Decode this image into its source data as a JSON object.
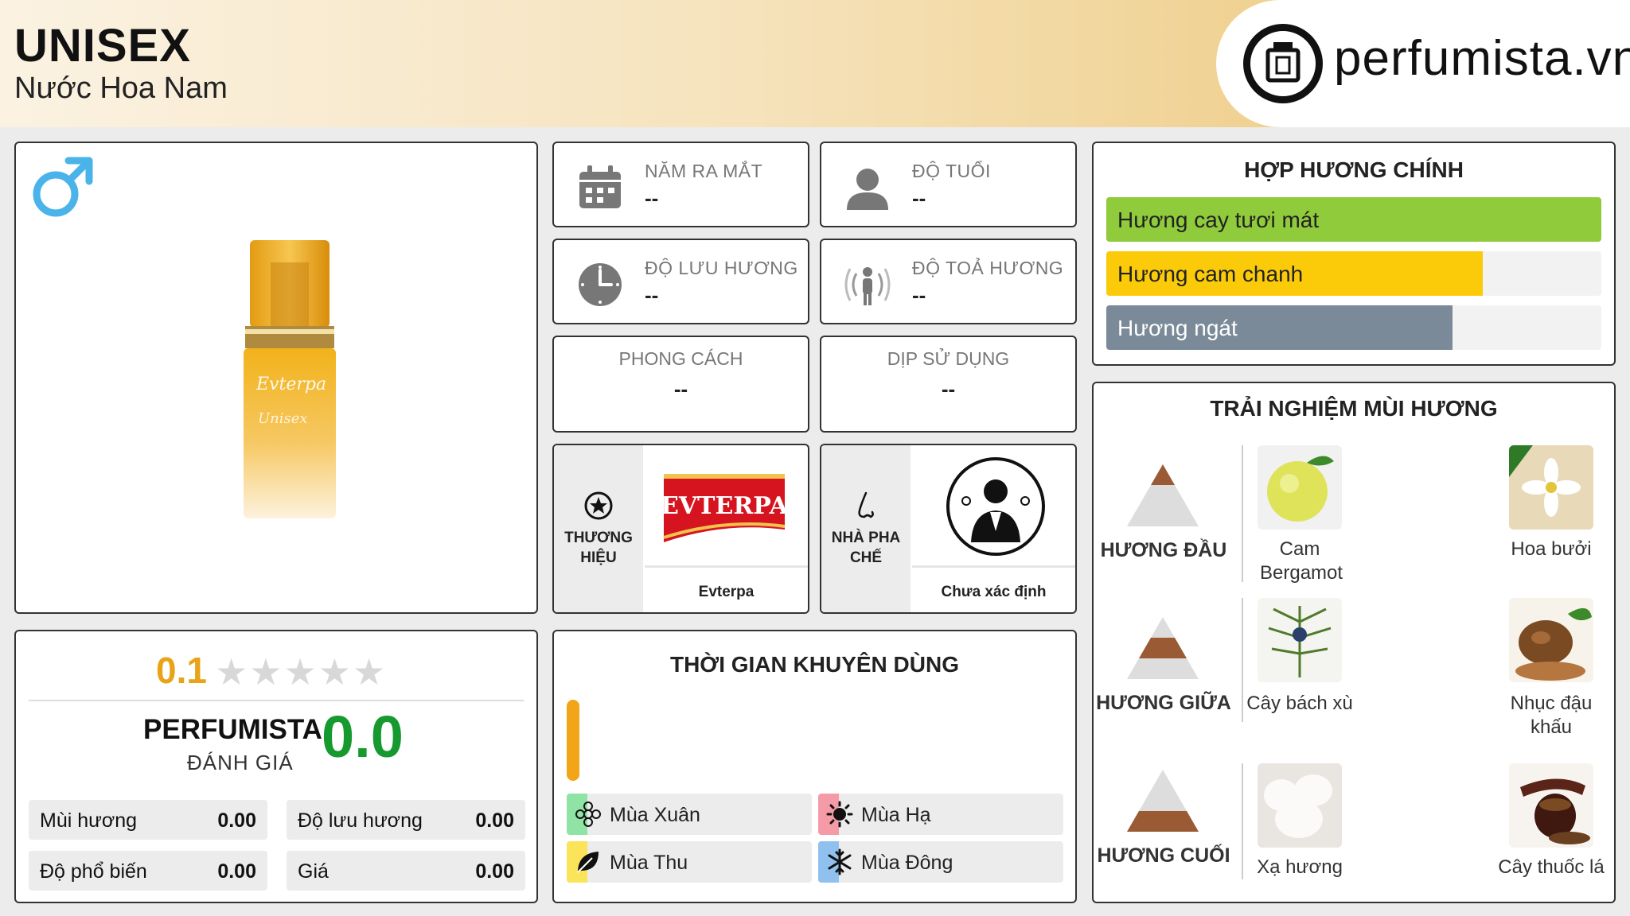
{
  "header": {
    "title": "UNISEX",
    "subtitle": "Nước Hoa Nam",
    "logo_text": "perfumista.vn"
  },
  "product": {
    "gender_icon": "male-icon",
    "gender_color": "#4ab3ea"
  },
  "info": {
    "release_year": {
      "label": "NĂM RA MẮT",
      "value": "--",
      "icon": "calendar-icon"
    },
    "age": {
      "label": "ĐỘ TUỔI",
      "value": "--",
      "icon": "user-icon"
    },
    "longevity": {
      "label": "ĐỘ LƯU HƯƠNG",
      "value": "--",
      "icon": "clock-icon"
    },
    "sillage": {
      "label": "ĐỘ TOẢ HƯƠNG",
      "value": "--",
      "icon": "radiate-icon"
    },
    "style": {
      "label": "PHONG CÁCH",
      "value": "--"
    },
    "occasion": {
      "label": "DỊP SỬ DỤNG",
      "value": "--"
    },
    "brand": {
      "label_line1": "THƯƠNG",
      "label_line2": "HIỆU",
      "logo_text": "EVTERPA",
      "name": "Evterpa",
      "icon": "star-icon"
    },
    "perfumer": {
      "label_line1": "NHÀ PHA",
      "label_line2": "CHẾ",
      "name": "Chưa xác định",
      "icon": "nose-icon"
    }
  },
  "accords": {
    "title": "HỢP HƯƠNG CHÍNH",
    "items": [
      {
        "label": "Hương cay tươi mát",
        "percent": 100,
        "color": "#8fcb3a",
        "text_color": "#222"
      },
      {
        "label": "Hương cam chanh",
        "percent": 76,
        "color": "#fbcb0a",
        "text_color": "#222"
      },
      {
        "label": "Hương ngát",
        "percent": 70,
        "color": "#7a8a99",
        "text_color": "#fff"
      }
    ]
  },
  "rating": {
    "user_score": "0.1",
    "stars_filled": 0,
    "stars_total": 5,
    "perfumista_title": "PERFUMISTA",
    "perfumista_sub": "ĐÁNH GIÁ",
    "perfumista_score": "0.0",
    "metrics": [
      {
        "label": "Mùi hương",
        "value": "0.00"
      },
      {
        "label": "Độ lưu hương",
        "value": "0.00"
      },
      {
        "label": "Độ phổ biến",
        "value": "0.00"
      },
      {
        "label": "Giá",
        "value": "0.00"
      }
    ]
  },
  "time": {
    "title": "THỜI GIAN KHUYÊN DÙNG",
    "bar_color": "#f2a516",
    "seasons": [
      {
        "label": "Mùa Xuân",
        "icon": "flower-icon",
        "accent": "#8fe3a5"
      },
      {
        "label": "Mùa Hạ",
        "icon": "sun-icon",
        "accent": "#f59aa7"
      },
      {
        "label": "Mùa Thu",
        "icon": "leaf-icon",
        "accent": "#fbe35a"
      },
      {
        "label": "Mùa Đông",
        "icon": "snowflake-icon",
        "accent": "#8fc0ee"
      }
    ]
  },
  "notes": {
    "title": "TRẢI NGHIỆM MÙI HƯƠNG",
    "tiers": [
      {
        "label": "HƯƠNG ĐẦU",
        "notes": [
          {
            "name": "Cam Bergamot"
          },
          {
            "name": "Hoa bưởi"
          }
        ]
      },
      {
        "label": "HƯƠNG GIỮA",
        "notes": [
          {
            "name": "Cây bách xù"
          },
          {
            "name": "Nhục đậu khấu"
          }
        ]
      },
      {
        "label": "HƯƠNG CUỐI",
        "notes": [
          {
            "name": "Xạ hương"
          },
          {
            "name": "Cây thuốc lá"
          }
        ]
      }
    ]
  }
}
